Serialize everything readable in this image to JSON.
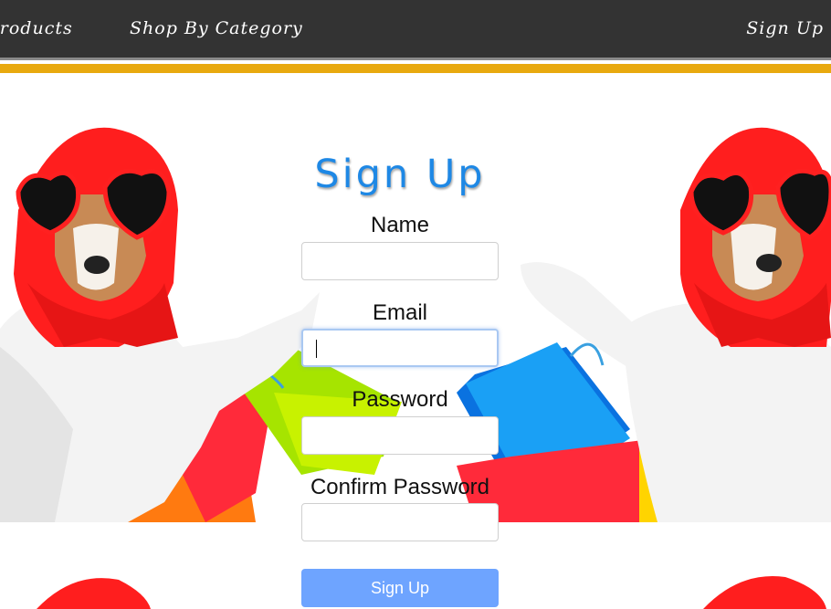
{
  "nav": {
    "products_label": "Products",
    "category_label": "Shop By Category",
    "signup_label": "Sign Up",
    "bg_color": "#333333",
    "accent_color": "#e8a90f"
  },
  "form": {
    "title": "Sign Up",
    "title_color": "#1e88e5",
    "fields": [
      {
        "label": "Name",
        "value": "",
        "focused": false
      },
      {
        "label": "Email",
        "value": "",
        "focused": true
      },
      {
        "label": "Password",
        "value": "",
        "focused": false
      },
      {
        "label": "Confirm Password",
        "value": "",
        "focused": false
      }
    ],
    "submit_label": "Sign Up",
    "submit_color": "#6ea4ff"
  },
  "background": {
    "image": "dog-with-shopping-bags",
    "icons": [
      "red-headscarf",
      "heart-sunglasses",
      "shopping-bags"
    ]
  }
}
